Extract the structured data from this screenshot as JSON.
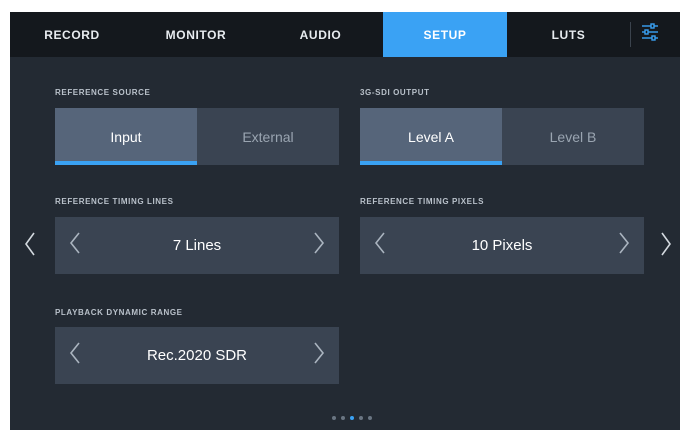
{
  "tabs": [
    {
      "label": "RECORD",
      "active": false
    },
    {
      "label": "MONITOR",
      "active": false
    },
    {
      "label": "AUDIO",
      "active": false
    },
    {
      "label": "SETUP",
      "active": true
    },
    {
      "label": "LUTS",
      "active": false
    }
  ],
  "icons": {
    "menu": "sliders-icon",
    "prev": "chevron-left-icon",
    "next": "chevron-right-icon"
  },
  "settings": {
    "reference_source": {
      "label": "REFERENCE SOURCE",
      "options": [
        "Input",
        "External"
      ],
      "selected": "Input"
    },
    "sdi_output": {
      "label": "3G-SDI OUTPUT",
      "options": [
        "Level A",
        "Level B"
      ],
      "selected": "Level A"
    },
    "timing_lines": {
      "label": "REFERENCE TIMING LINES",
      "value": "7 Lines"
    },
    "timing_pixels": {
      "label": "REFERENCE TIMING PIXELS",
      "value": "10 Pixels"
    },
    "dynamic_range": {
      "label": "PLAYBACK DYNAMIC RANGE",
      "value": "Rec.2020 SDR"
    }
  },
  "pagination": {
    "total": 5,
    "current": 3
  },
  "colors": {
    "accent": "#3aa2f4",
    "panel": "#3a4452",
    "selected": "#56657a",
    "background": "#232a33",
    "tabbar": "#14181d"
  }
}
